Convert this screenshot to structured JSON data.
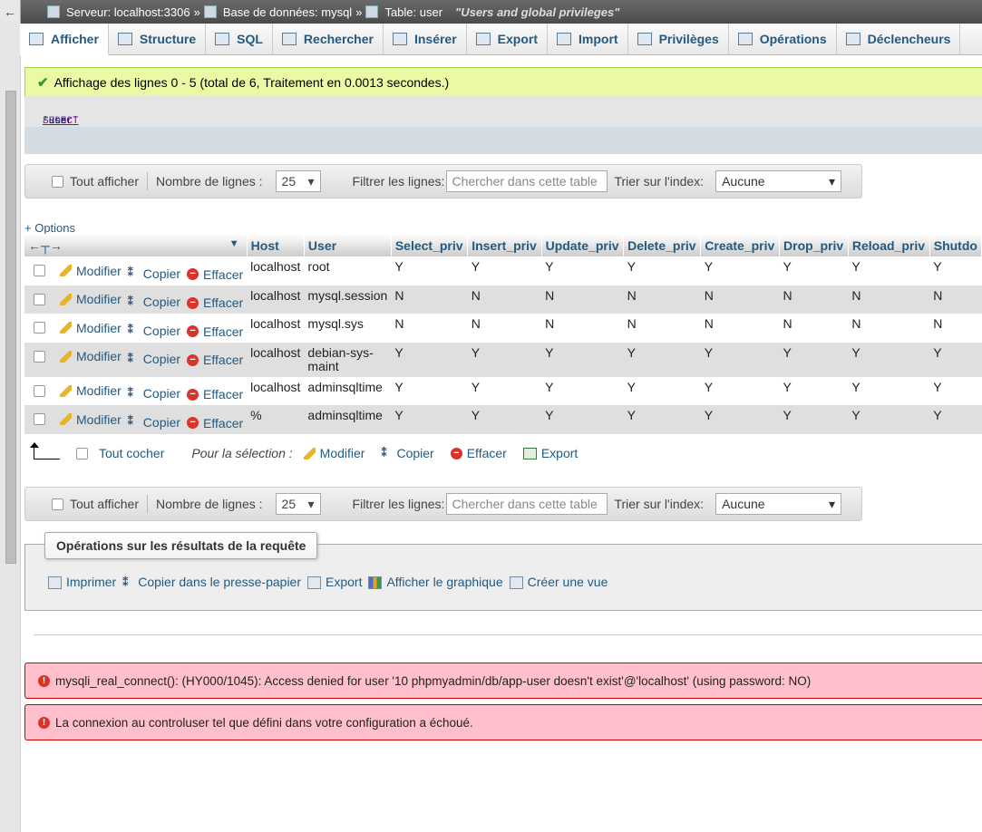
{
  "breadcrumb": {
    "back": "←",
    "server": "Serveur: localhost:3306",
    "database": "Base de données: mysql",
    "table": "Table: user",
    "comment": "\"Users and global privileges\"",
    "sep": "»"
  },
  "tabs": [
    {
      "label": "Afficher",
      "icon": "browse-icon"
    },
    {
      "label": "Structure",
      "icon": "structure-icon"
    },
    {
      "label": "SQL",
      "icon": "sql-icon"
    },
    {
      "label": "Rechercher",
      "icon": "search-icon"
    },
    {
      "label": "Insérer",
      "icon": "insert-icon"
    },
    {
      "label": "Export",
      "icon": "export-icon"
    },
    {
      "label": "Import",
      "icon": "import-icon"
    },
    {
      "label": "Privilèges",
      "icon": "privileges-icon"
    },
    {
      "label": "Opérations",
      "icon": "wrench-icon"
    },
    {
      "label": "Déclencheurs",
      "icon": "triggers-icon"
    }
  ],
  "success_message": "Affichage des lignes 0 - 5 (total de 6, Traitement en 0.0013 secondes.)",
  "sql": {
    "kw1": "SELECT",
    "star": "*",
    "kw2": "FROM",
    "table": "`user`"
  },
  "nav": {
    "show_all": "Tout afficher",
    "rows_label": "Nombre de lignes :",
    "rows_value": "25",
    "filter_label": "Filtrer les lignes:",
    "filter_placeholder": "Chercher dans cette table",
    "sort_label": "Trier sur l'index:",
    "sort_value": "Aucune"
  },
  "options_link": "+ Options",
  "table": {
    "columns": [
      "Host",
      "User",
      "Select_priv",
      "Insert_priv",
      "Update_priv",
      "Delete_priv",
      "Create_priv",
      "Drop_priv",
      "Reload_priv",
      "Shutdo"
    ],
    "actions": {
      "edit": "Modifier",
      "copy": "Copier",
      "delete": "Effacer"
    },
    "rows": [
      [
        "localhost",
        "root",
        "Y",
        "Y",
        "Y",
        "Y",
        "Y",
        "Y",
        "Y",
        "Y"
      ],
      [
        "localhost",
        "mysql.session",
        "N",
        "N",
        "N",
        "N",
        "N",
        "N",
        "N",
        "N"
      ],
      [
        "localhost",
        "mysql.sys",
        "N",
        "N",
        "N",
        "N",
        "N",
        "N",
        "N",
        "N"
      ],
      [
        "localhost",
        "debian-sys-\nmaint",
        "Y",
        "Y",
        "Y",
        "Y",
        "Y",
        "Y",
        "Y",
        "Y"
      ],
      [
        "localhost",
        "adminsqltime",
        "Y",
        "Y",
        "Y",
        "Y",
        "Y",
        "Y",
        "Y",
        "Y"
      ],
      [
        "%",
        "adminsqltime",
        "Y",
        "Y",
        "Y",
        "Y",
        "Y",
        "Y",
        "Y",
        "Y"
      ]
    ]
  },
  "bulk": {
    "check_all": "Tout cocher",
    "for_selection": "Pour la sélection :",
    "edit": "Modifier",
    "copy": "Copier",
    "delete": "Effacer",
    "export": "Export"
  },
  "query_ops": {
    "title": "Opérations sur les résultats de la requête",
    "print": "Imprimer",
    "copy_clipboard": "Copier dans le presse-papier",
    "export": "Export",
    "chart": "Afficher le graphique",
    "create_view": "Créer une vue"
  },
  "errors": [
    "mysqli_real_connect(): (HY000/1045): Access denied for user '10 phpmyadmin/db/app-user doesn't exist'@'localhost' (using password: NO)",
    "La connexion au controluser tel que défini dans votre configuration a échoué."
  ]
}
